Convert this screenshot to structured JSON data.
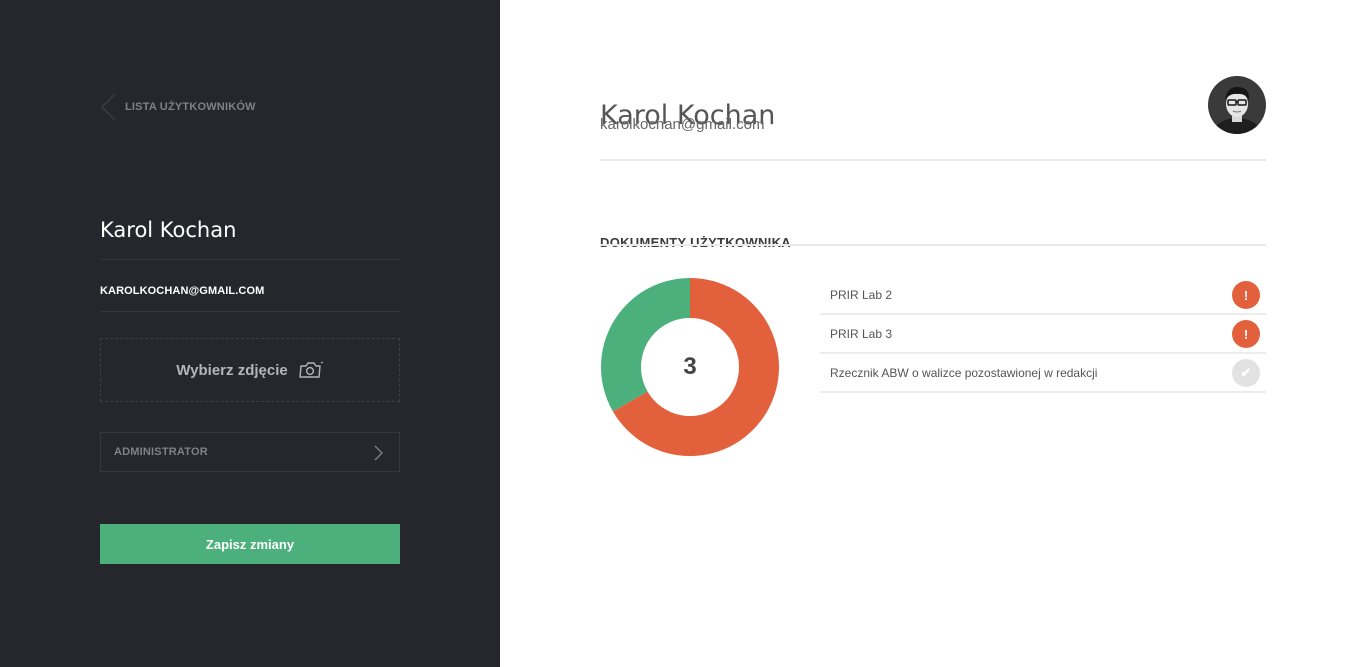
{
  "sidebar": {
    "back_label": "LISTA UŻYTKOWNIKÓW",
    "user_name": "Karol Kochan",
    "user_email": "KAROLKOCHAN@GMAIL.COM",
    "photo_label": "Wybierz zdjęcie",
    "role_label": "ADMINISTRATOR",
    "save_label": "Zapisz zmiany"
  },
  "main": {
    "user_name": "Karol Kochan",
    "user_email": "karolkochan@gmail.com",
    "section_title": "DOKUMENTY UŻYTKOWNIKA",
    "documents": [
      {
        "name": "PRIR Lab 2",
        "status": "error",
        "status_icon": "exclamation-icon",
        "status_glyph": "!"
      },
      {
        "name": "PRIR Lab 3",
        "status": "error",
        "status_icon": "exclamation-icon",
        "status_glyph": "!"
      },
      {
        "name": "Rzecznik ABW o walizce pozostawionej w redakcji",
        "status": "ok",
        "status_icon": "check-icon",
        "status_glyph": "✔"
      }
    ]
  },
  "chart_data": {
    "type": "pie",
    "center_label": "3",
    "segments": [
      {
        "label": "error",
        "value": 2,
        "color": "#e3603d"
      },
      {
        "label": "ok",
        "value": 1,
        "color": "#4bb07b"
      }
    ]
  },
  "colors": {
    "sidebar_bg": "#25272c",
    "accent_green": "#4bb07b",
    "error_red": "#e3603d",
    "ok_gray": "#e2e2e2"
  }
}
